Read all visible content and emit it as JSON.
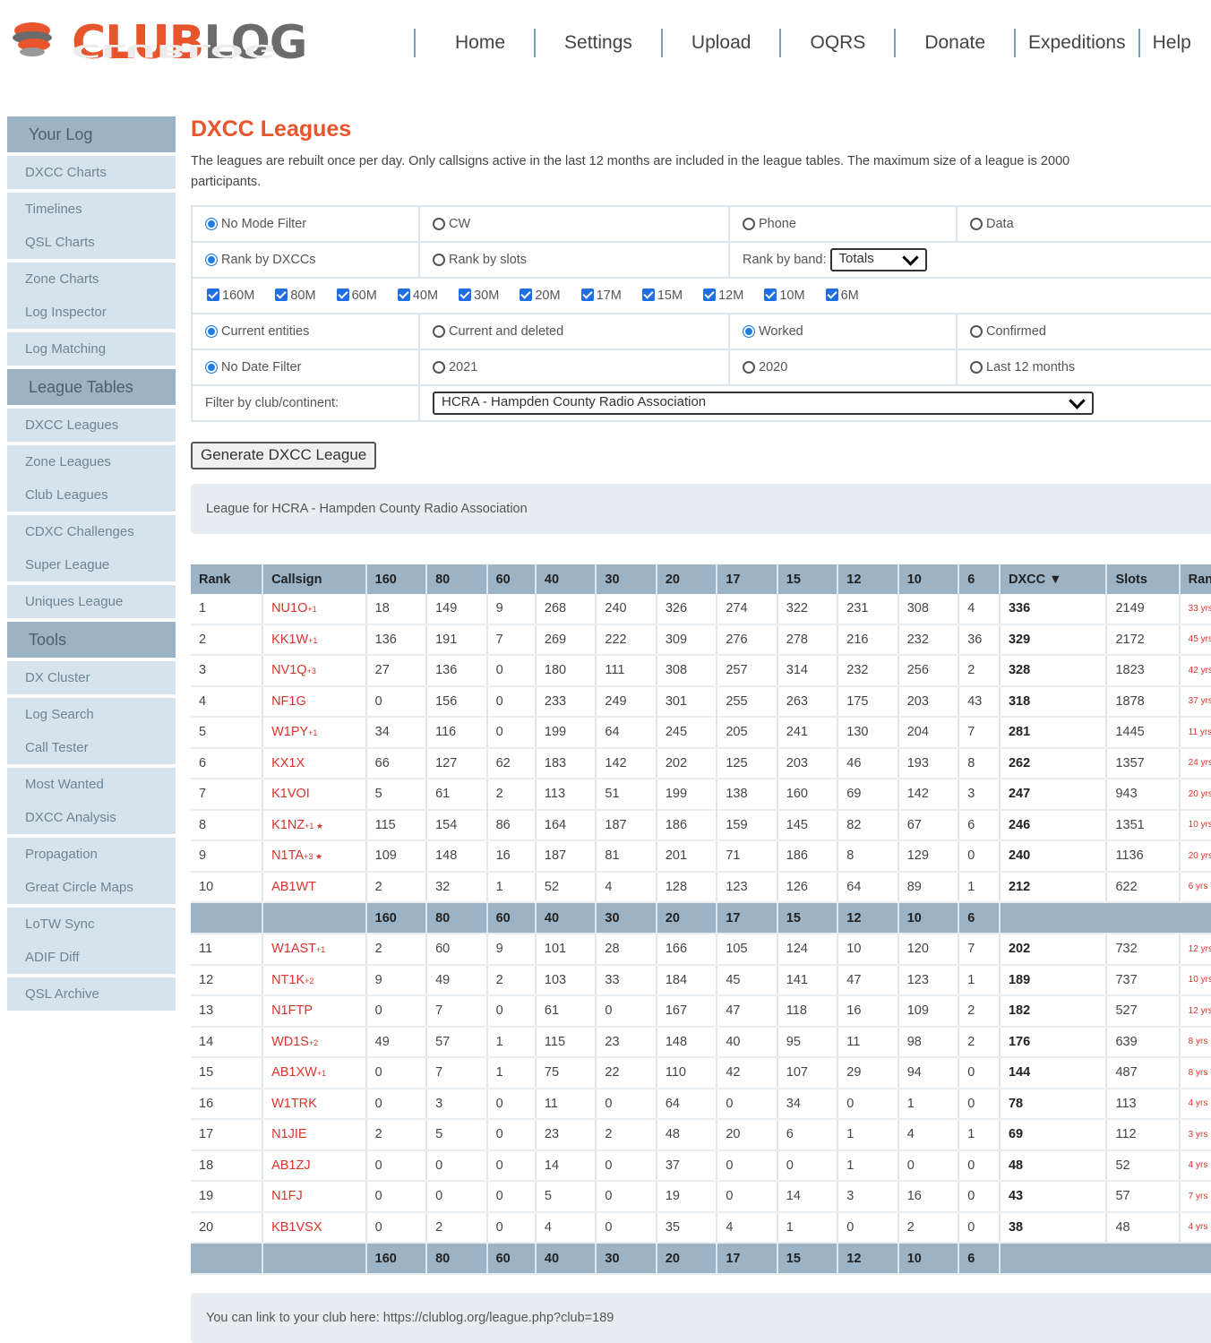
{
  "brand": {
    "club": "CLUB",
    "log": "LOG",
    "accent": "#e8542c"
  },
  "topnav": [
    "Home",
    "Settings",
    "Upload",
    "OQRS",
    "Donate",
    "Expeditions",
    "Help"
  ],
  "sidebar": {
    "your_log": "Your Log",
    "your_log_items": [
      "DXCC Charts",
      "Timelines",
      "QSL Charts",
      "Zone Charts",
      "Log Inspector",
      "Log Matching"
    ],
    "league_tables": "League Tables",
    "league_items": [
      "DXCC Leagues",
      "Zone Leagues",
      "Club Leagues",
      "CDXC Challenges",
      "Super League",
      "Uniques League"
    ],
    "tools": "Tools",
    "tools_items": [
      "DX Cluster",
      "Log Search",
      "Call Tester",
      "Most Wanted",
      "DXCC Analysis",
      "Propagation",
      "Great Circle Maps",
      "LoTW Sync",
      "ADIF Diff",
      "QSL Archive"
    ]
  },
  "page": {
    "title": "DXCC Leagues",
    "intro1": "The leagues are rebuilt once per day. Only callsigns active in the last 12 months are included in the league tables. The maximum size of a league is 2000",
    "intro2": "participants."
  },
  "filters": {
    "mode": [
      "No Mode Filter",
      "CW",
      "Phone",
      "Data"
    ],
    "rank": [
      "Rank by DXCCs",
      "Rank by slots"
    ],
    "rank_by_band_label": "Rank by band:",
    "rank_by_band_value": "Totals",
    "bands": [
      "160M",
      "80M",
      "60M",
      "40M",
      "30M",
      "20M",
      "17M",
      "15M",
      "12M",
      "10M",
      "6M"
    ],
    "entities": [
      "Current entities",
      "Current and deleted",
      "Worked",
      "Confirmed"
    ],
    "dates": [
      "No Date Filter",
      "2021",
      "2020",
      "Last 12 months"
    ],
    "club_label": "Filter by club/continent:",
    "club_value": "HCRA - Hampden County Radio Association",
    "generate_button": "Generate DXCC League"
  },
  "league_title": "League for HCRA - Hampden County Radio Association",
  "table": {
    "headers": [
      "Rank",
      "Callsign",
      "160",
      "80",
      "60",
      "40",
      "30",
      "20",
      "17",
      "15",
      "12",
      "10",
      "6",
      "DXCC ▼",
      "Slots",
      "Range"
    ],
    "band_headers": [
      "160",
      "80",
      "60",
      "40",
      "30",
      "20",
      "17",
      "15",
      "12",
      "10",
      "6"
    ],
    "rows": [
      [
        "1",
        "NU1O",
        "+1",
        "18",
        "149",
        "9",
        "268",
        "240",
        "326",
        "274",
        "322",
        "231",
        "308",
        "4",
        "336",
        "2149",
        "33 yrs"
      ],
      [
        "2",
        "KK1W",
        "+1",
        "136",
        "191",
        "7",
        "269",
        "222",
        "309",
        "276",
        "278",
        "216",
        "232",
        "36",
        "329",
        "2172",
        "45 yrs"
      ],
      [
        "3",
        "NV1Q",
        "+3",
        "27",
        "136",
        "0",
        "180",
        "111",
        "308",
        "257",
        "314",
        "232",
        "256",
        "2",
        "328",
        "1823",
        "42 yrs"
      ],
      [
        "4",
        "NF1G",
        "",
        "0",
        "156",
        "0",
        "233",
        "249",
        "301",
        "255",
        "263",
        "175",
        "203",
        "43",
        "318",
        "1878",
        "37 yrs"
      ],
      [
        "5",
        "W1PY",
        "+1",
        "34",
        "116",
        "0",
        "199",
        "64",
        "245",
        "205",
        "241",
        "130",
        "204",
        "7",
        "281",
        "1445",
        "11 yrs"
      ],
      [
        "6",
        "KX1X",
        "",
        "66",
        "127",
        "62",
        "183",
        "142",
        "202",
        "125",
        "203",
        "46",
        "193",
        "8",
        "262",
        "1357",
        "24 yrs"
      ],
      [
        "7",
        "K1VOI",
        "",
        "5",
        "61",
        "2",
        "113",
        "51",
        "199",
        "138",
        "160",
        "69",
        "142",
        "3",
        "247",
        "943",
        "20 yrs"
      ],
      [
        "8",
        "K1NZ",
        "+1 ★",
        "115",
        "154",
        "86",
        "164",
        "187",
        "186",
        "159",
        "145",
        "82",
        "67",
        "6",
        "246",
        "1351",
        "10 yrs"
      ],
      [
        "9",
        "N1TA",
        "+3 ★",
        "109",
        "148",
        "16",
        "187",
        "81",
        "201",
        "71",
        "186",
        "8",
        "129",
        "0",
        "240",
        "1136",
        "20 yrs"
      ],
      [
        "10",
        "AB1WT",
        "",
        "2",
        "32",
        "1",
        "52",
        "4",
        "128",
        "123",
        "126",
        "64",
        "89",
        "1",
        "212",
        "622",
        "6 yrs"
      ]
    ],
    "rows2": [
      [
        "11",
        "W1AST",
        "+1",
        "2",
        "60",
        "9",
        "101",
        "28",
        "166",
        "105",
        "124",
        "10",
        "120",
        "7",
        "202",
        "732",
        "12 yrs"
      ],
      [
        "12",
        "NT1K",
        "+2",
        "9",
        "49",
        "2",
        "103",
        "33",
        "184",
        "45",
        "141",
        "47",
        "123",
        "1",
        "189",
        "737",
        "10 yrs"
      ],
      [
        "13",
        "N1FTP",
        "",
        "0",
        "7",
        "0",
        "61",
        "0",
        "167",
        "47",
        "118",
        "16",
        "109",
        "2",
        "182",
        "527",
        "12 yrs"
      ],
      [
        "14",
        "WD1S",
        "+2",
        "49",
        "57",
        "1",
        "115",
        "23",
        "148",
        "40",
        "95",
        "11",
        "98",
        "2",
        "176",
        "639",
        "8 yrs"
      ],
      [
        "15",
        "AB1XW",
        "+1",
        "0",
        "7",
        "1",
        "75",
        "22",
        "110",
        "42",
        "107",
        "29",
        "94",
        "0",
        "144",
        "487",
        "8 yrs"
      ],
      [
        "16",
        "W1TRK",
        "",
        "0",
        "3",
        "0",
        "11",
        "0",
        "64",
        "0",
        "34",
        "0",
        "1",
        "0",
        "78",
        "113",
        "4 yrs"
      ],
      [
        "17",
        "N1JIE",
        "",
        "2",
        "5",
        "0",
        "23",
        "2",
        "48",
        "20",
        "6",
        "1",
        "4",
        "1",
        "69",
        "112",
        "3 yrs"
      ],
      [
        "18",
        "AB1ZJ",
        "",
        "0",
        "0",
        "0",
        "14",
        "0",
        "37",
        "0",
        "0",
        "1",
        "0",
        "0",
        "48",
        "52",
        "4 yrs"
      ],
      [
        "19",
        "N1FJ",
        "",
        "0",
        "0",
        "0",
        "5",
        "0",
        "19",
        "0",
        "14",
        "3",
        "16",
        "0",
        "43",
        "57",
        "7 yrs"
      ],
      [
        "20",
        "KB1VSX",
        "",
        "0",
        "2",
        "0",
        "4",
        "0",
        "35",
        "4",
        "1",
        "0",
        "2",
        "0",
        "38",
        "48",
        "4 yrs"
      ]
    ]
  },
  "footer": "You can link to your club here: https://clublog.org/league.php?club=189"
}
